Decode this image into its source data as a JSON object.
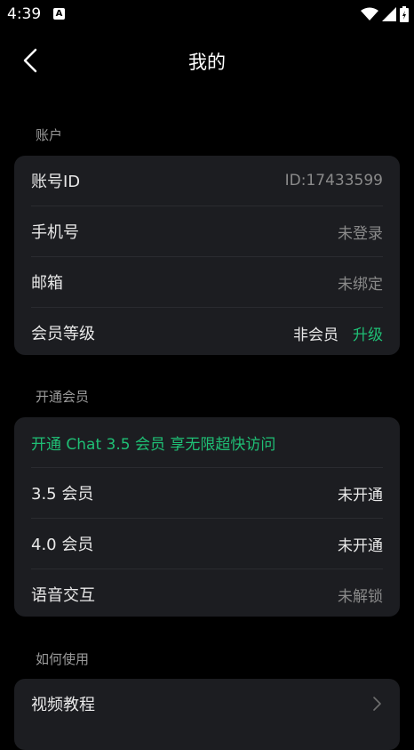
{
  "status_bar": {
    "time": "4:39",
    "notification_icon": "A"
  },
  "header": {
    "title": "我的",
    "back_icon": "chevron-left-icon"
  },
  "account": {
    "section_label": "账户",
    "rows": [
      {
        "label": "账号ID",
        "value": "ID:17433599"
      },
      {
        "label": "手机号",
        "value": "未登录"
      },
      {
        "label": "邮箱",
        "value": "未绑定"
      },
      {
        "label": "会员等级",
        "value": "非会员",
        "action": "升级"
      }
    ]
  },
  "membership": {
    "section_label": "开通会员",
    "promo": "开通 Chat 3.5 会员 享无限超快访问",
    "rows": [
      {
        "label": "3.5 会员",
        "value": "未开通"
      },
      {
        "label": "4.0 会员",
        "value": "未开通"
      },
      {
        "label": "语音交互",
        "value": "未解锁"
      }
    ]
  },
  "howto": {
    "section_label": "如何使用",
    "rows": [
      {
        "label": "视频教程",
        "icon": "chevron-right-icon"
      }
    ]
  },
  "colors": {
    "accent": "#1fbf75",
    "card_bg": "#1c1d21",
    "background": "#000000"
  }
}
